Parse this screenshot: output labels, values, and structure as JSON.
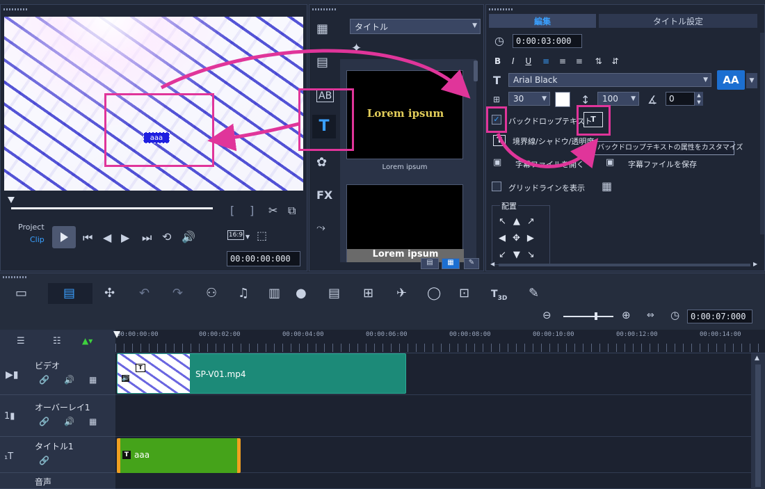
{
  "preview": {
    "overlay_text": "aaa",
    "project_label": "Project",
    "clip_label": "Clip",
    "aspect": "16:9",
    "timecode": "00:00:00:000"
  },
  "library": {
    "category": "タイトル",
    "thumb1_text": "Lorem ipsum",
    "thumb1_caption": "Lorem ipsum",
    "thumb2_text": "Lorem ipsum",
    "fx_label": "FX"
  },
  "options": {
    "tab_edit": "編集",
    "tab_title_settings": "タイトル設定",
    "duration": "0:00:03:000",
    "font_name": "Arial Black",
    "font_size": "30",
    "line_spacing": "100",
    "angle": "0",
    "aa_label": "AA",
    "backdrop_label": "バックドロップテキスト",
    "border_label": "境界線/シャドウ/透明度",
    "tooltip": "バックドロップテキストの属性をカスタマイズ",
    "open_subtitle": "字幕ファイルを開く",
    "save_subtitle": "字幕ファイルを保存",
    "gridline_label": "グリッドラインを表示",
    "align_label": "配置"
  },
  "timeline": {
    "timecode": "0:00:07:000",
    "ruler": [
      "00:00:00:00",
      "00:00:02:00",
      "00:00:04:00",
      "00:00:06:00",
      "00:00:08:00",
      "00:00:10:00",
      "00:00:12:00",
      "00:00:14:00"
    ],
    "tracks": {
      "video": "ビデオ",
      "overlay": "オーバーレイ1",
      "title": "タイトル1",
      "audio": "音声"
    },
    "video_clip": "SP-V01.mp4",
    "title_clip": "aaa"
  },
  "colors": {
    "accent_magenta": "#e0359a",
    "video_clip": "#1c8a78",
    "title_clip": "#45a31a"
  }
}
